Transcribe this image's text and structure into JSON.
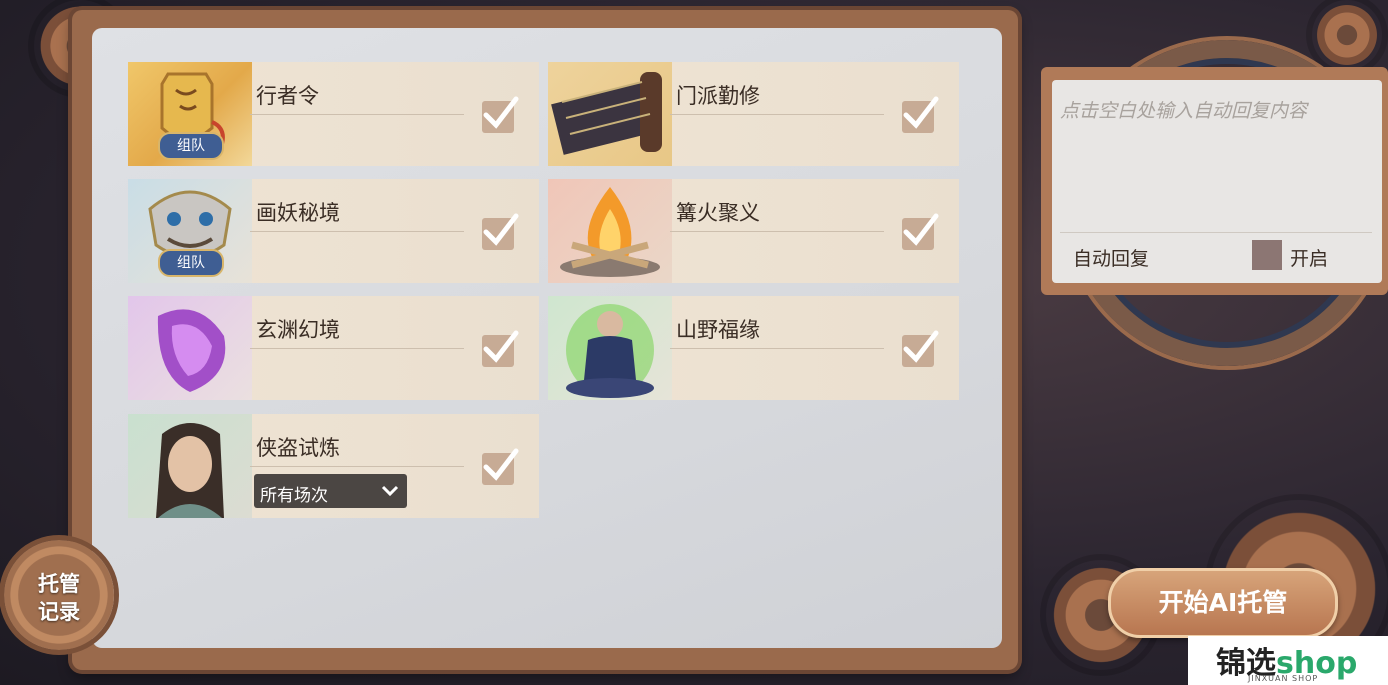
{
  "tasks": [
    {
      "title": "行者令",
      "badge": "组队",
      "checked": true
    },
    {
      "title": "门派勤修",
      "checked": true
    },
    {
      "title": "画妖秘境",
      "badge": "组队",
      "checked": true
    },
    {
      "title": "篝火聚义",
      "checked": true
    },
    {
      "title": "玄渊幻境",
      "checked": true
    },
    {
      "title": "山野福缘",
      "checked": true
    },
    {
      "title": "侠盗试炼",
      "checked": true,
      "dropdown": "所有场次"
    }
  ],
  "auto_reply": {
    "placeholder": "点击空白处输入自动回复内容",
    "label": "自动回复",
    "toggle_label": "开启",
    "enabled": false
  },
  "buttons": {
    "start": "开始AI托管",
    "record_line1": "托管",
    "record_line2": "记录"
  },
  "watermark": {
    "brand_cn": "锦选",
    "brand_en": "shop",
    "sub": "JINXUAN SHOP"
  }
}
